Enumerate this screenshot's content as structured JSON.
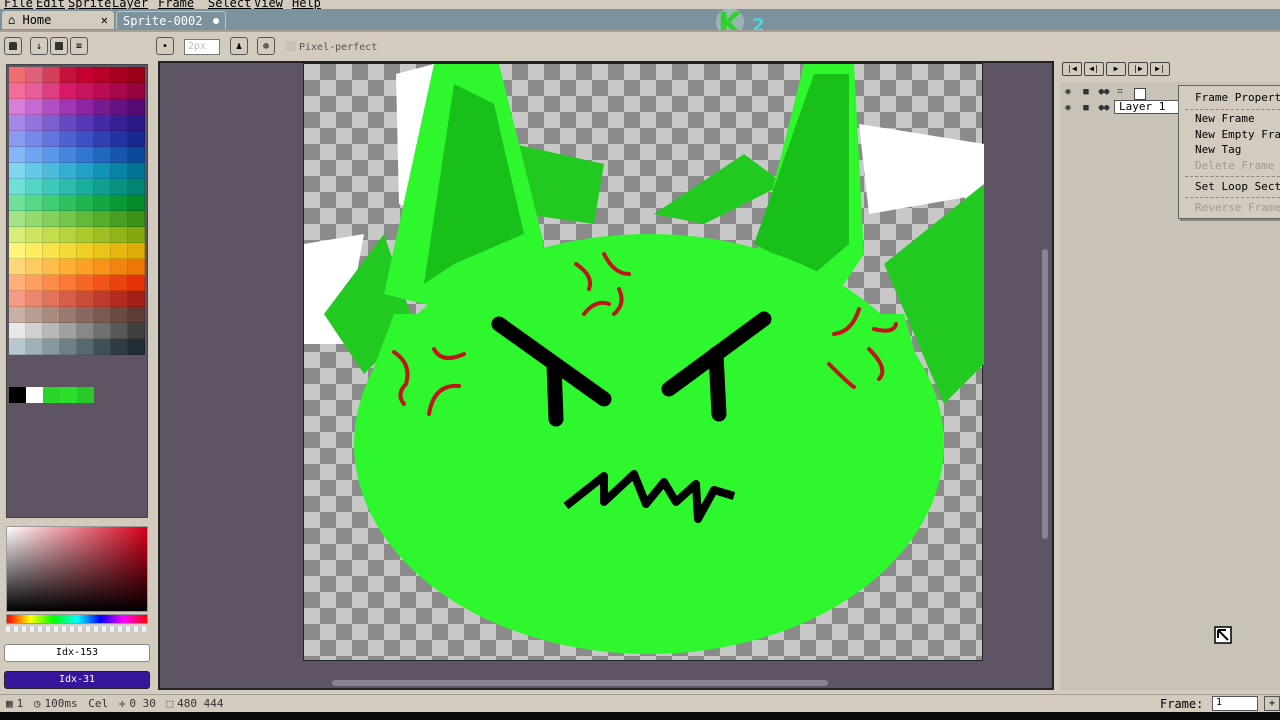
{
  "menu": {
    "items": [
      "File",
      "Edit",
      "Sprite",
      "Layer",
      "Frame",
      "Select",
      "View",
      "Help"
    ]
  },
  "logo": {
    "text": "K",
    "badge": "2"
  },
  "tabs": [
    {
      "label": "Home",
      "close": "✕"
    },
    {
      "label": "Sprite-0002"
    }
  ],
  "toolbar": {
    "brush_size_placeholder": "2px",
    "pixel_perfect_label": "Pixel-perfect"
  },
  "palette": {
    "colors": [
      "#f26e6e",
      "#e0607a",
      "#d4405a",
      "#c5123a",
      "#c80032",
      "#b80028",
      "#a8001e",
      "#9a0016",
      "#f56b9c",
      "#ea5c95",
      "#df3f80",
      "#d61a68",
      "#c9135f",
      "#bb0b55",
      "#a8084b",
      "#970540",
      "#d67ed8",
      "#c56ad1",
      "#b14fc3",
      "#9f36b4",
      "#8c24a3",
      "#781a92",
      "#661284",
      "#560c76",
      "#a487e6",
      "#9175dd",
      "#7c60d2",
      "#6748c4",
      "#5638b6",
      "#4529a6",
      "#371f95",
      "#2c1885",
      "#8a9af0",
      "#7888ea",
      "#6475df",
      "#4f60d2",
      "#3f4fc4",
      "#3040b4",
      "#2433a3",
      "#1a2892",
      "#84b7f5",
      "#6ea7f0",
      "#5a97e8",
      "#4486dd",
      "#3176cf",
      "#2166bf",
      "#1457ad",
      "#0b4a9a",
      "#7fd6ee",
      "#63c9e6",
      "#4cbcdc",
      "#34aed2",
      "#23a0c5",
      "#1491b6",
      "#0a82a5",
      "#057494",
      "#6fe0d4",
      "#55d5c8",
      "#3ec9bb",
      "#2bbcad",
      "#1aae9f",
      "#0fa090",
      "#079281",
      "#038473",
      "#6ee29a",
      "#56d886",
      "#40cd73",
      "#2ec160",
      "#1fb450",
      "#13a742",
      "#0a9835",
      "#05892a",
      "#a4e384",
      "#93da6f",
      "#83d15c",
      "#72c649",
      "#63ba39",
      "#54ae2b",
      "#47a01f",
      "#3a9215",
      "#d8ec78",
      "#cde561",
      "#c2dd4e",
      "#b6d43d",
      "#aaca2e",
      "#9ebf22",
      "#92b418",
      "#86a80f",
      "#fff47a",
      "#fcec61",
      "#f9e34a",
      "#f5d936",
      "#f1ce26",
      "#ecc319",
      "#e6b70f",
      "#dfab07",
      "#ffd77a",
      "#ffca61",
      "#ffbc4a",
      "#ffae36",
      "#fca026",
      "#f89219",
      "#f3840f",
      "#ee7607",
      "#ffb07a",
      "#ff9e61",
      "#ff8b4a",
      "#fd7836",
      "#f96526",
      "#f35319",
      "#ec420f",
      "#e33307",
      "#f59a84",
      "#ec866f",
      "#e2725c",
      "#d75e49",
      "#cb4c39",
      "#bf3b2b",
      "#b22c1f",
      "#a41f15",
      "#c8b0a4",
      "#b89e92",
      "#a88c80",
      "#987a6f",
      "#89695f",
      "#7a5950",
      "#6b4a42",
      "#5d3c35",
      "#e8e8e8",
      "#d0d0d0",
      "#b8b8b8",
      "#a0a0a0",
      "#888888",
      "#707070",
      "#585858",
      "#404040",
      "#b8c8d0",
      "#a0b0b8",
      "#8898a0",
      "#708088",
      "#586870",
      "#405058",
      "#303c44",
      "#222c34"
    ],
    "extra_colors": [
      "#000000",
      "#ffffff",
      "#2bd42b",
      "#2ae02a",
      "#28c828"
    ]
  },
  "color_fields": {
    "foreground": "Idx-153",
    "background": "Idx-31"
  },
  "right_panel": {
    "layer_name": "Layer 1"
  },
  "context_menu": {
    "items": [
      {
        "label": "Frame Properties...",
        "disabled": false
      },
      {
        "label": "New Frame",
        "disabled": false
      },
      {
        "label": "New Empty Frame",
        "disabled": false
      },
      {
        "label": "New Tag",
        "disabled": false
      },
      {
        "label": "Delete Frame",
        "disabled": true
      },
      {
        "label": "Set Loop Section",
        "disabled": false
      },
      {
        "label": "Reverse Frames",
        "disabled": true
      }
    ]
  },
  "status": {
    "frame": "1",
    "duration": "100ms",
    "cel": "Cel",
    "pos": "0 30",
    "size": "480 444",
    "frame_label": "Frame:",
    "frame_value": "1",
    "frame_add": "+"
  },
  "colors": {
    "panel": "#d3cbbe",
    "editor_bg": "#5f5464",
    "slime": "#2ef72e",
    "slime_dark": "#19c019",
    "anger_red": "#c0161b"
  }
}
